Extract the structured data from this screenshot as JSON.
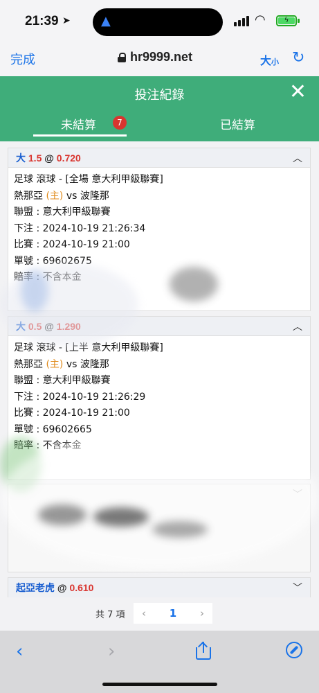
{
  "status_bar": {
    "time": "21:39",
    "battery_icon": "battery-charging-icon"
  },
  "browser": {
    "done_label": "完成",
    "url": "hr9999.net",
    "text_size_label": "大",
    "text_size_small": "小"
  },
  "header": {
    "title": "投注紀錄",
    "tabs": [
      {
        "label": "未結算",
        "badge": "7",
        "active": true
      },
      {
        "label": "已結算",
        "active": false
      }
    ]
  },
  "bets": [
    {
      "side": "大",
      "line": "1.5",
      "at": "@",
      "odds": "0.720",
      "expanded": true,
      "type_line": "足球 滾球 - [全場 意大利甲級聯賽]",
      "home": "熱那亞",
      "home_tag": "(主)",
      "vs": "vs",
      "away": "波隆那",
      "league": "聯盟 : 意大利甲級聯賽",
      "placed": "下注 : 2024-10-19 21:26:34",
      "match": "比賽 : 2024-10-19 21:00",
      "ticket": "單號 : 69602675",
      "payout": "賠率 : 不含本金"
    },
    {
      "side": "大",
      "line": "0.5",
      "at": "@",
      "odds": "1.290",
      "expanded": true,
      "type_line": "足球 滾球 - [上半 意大利甲級聯賽]",
      "home": "熱那亞",
      "home_tag": "(主)",
      "vs": "vs",
      "away": "波隆那",
      "league": "聯盟 : 意大利甲級聯賽",
      "placed": "下注 : 2024-10-19 21:26:29",
      "match": "比賽 : 2024-10-19 21:00",
      "ticket": "單號 : 69602665",
      "payout": "賠率 : 不含本金"
    },
    {
      "side": "起亞老虎",
      "at": "@",
      "odds": "0.610",
      "expanded": false
    }
  ],
  "pager": {
    "total": "共 7 項",
    "prev": "‹",
    "page": "1",
    "next": "›"
  },
  "colors": {
    "header_green": "#3fad7a",
    "accent_blue": "#1a73e8",
    "odds_red": "#d9352f",
    "home_orange": "#e08a1a"
  }
}
